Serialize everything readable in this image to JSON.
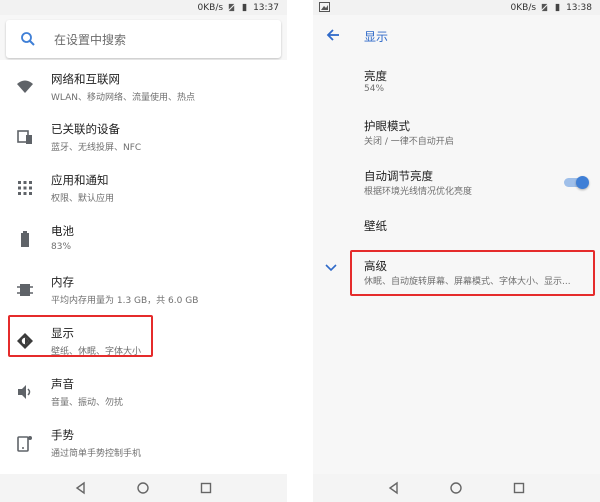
{
  "left": {
    "status": {
      "speed": "0KB/s",
      "time": "13:37"
    },
    "search": {
      "placeholder": "在设置中搜索"
    },
    "items": [
      {
        "title": "网络和互联网",
        "sub": "WLAN、移动网络、流量使用、热点",
        "icon": "wifi-icon"
      },
      {
        "title": "已关联的设备",
        "sub": "蓝牙、无线投屏、NFC",
        "icon": "devices-icon"
      },
      {
        "title": "应用和通知",
        "sub": "权限、默认应用",
        "icon": "apps-icon"
      },
      {
        "title": "电池",
        "sub": "83%",
        "icon": "battery-icon"
      },
      {
        "title": "内存",
        "sub": "平均内存用量为 1.3 GB，共 6.0 GB",
        "icon": "memory-icon"
      },
      {
        "title": "显示",
        "sub": "壁纸、休眠、字体大小",
        "icon": "display-icon"
      },
      {
        "title": "声音",
        "sub": "音量、振动、勿扰",
        "icon": "sound-icon"
      },
      {
        "title": "手势",
        "sub": "通过简单手势控制手机",
        "icon": "gesture-icon"
      }
    ]
  },
  "right": {
    "status": {
      "speed": "0KB/s",
      "time": "13:38"
    },
    "appbar": {
      "title": "显示"
    },
    "items": [
      {
        "title": "亮度",
        "sub": "54%"
      },
      {
        "title": "护眼模式",
        "sub": "关闭 / 一律不自动开启"
      },
      {
        "title": "自动调节亮度",
        "sub": "根据环境光线情况优化亮度",
        "toggle_on": true
      },
      {
        "title": "壁纸",
        "sub": ""
      },
      {
        "title": "高级",
        "sub": "休眠、自动旋转屏幕、屏幕模式、字体大小、显示..."
      }
    ]
  },
  "colors": {
    "accent": "#2f6ac9",
    "highlight": "#e52b2b",
    "toggle": "#3f7fd6"
  }
}
